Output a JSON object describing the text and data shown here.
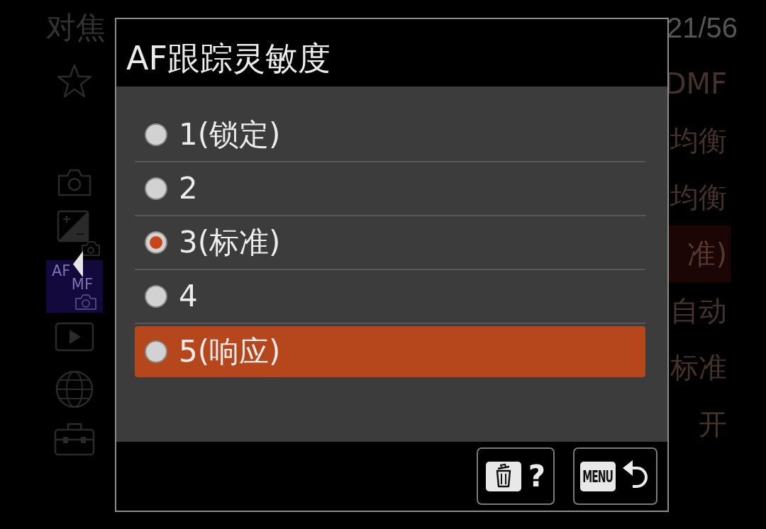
{
  "background_menu": {
    "breadcrumb": "对焦",
    "page_counter": "21/56",
    "tabs": [
      {
        "kind": "star",
        "selected": false
      },
      {
        "kind": "camera",
        "selected": false
      },
      {
        "kind": "exposure",
        "selected": false
      },
      {
        "kind": "focus",
        "labels": [
          "AF",
          "MF"
        ],
        "selected": true
      },
      {
        "kind": "play",
        "selected": false
      },
      {
        "kind": "network",
        "selected": false
      },
      {
        "kind": "toolbox",
        "selected": false
      }
    ],
    "values": [
      {
        "text": "DMF",
        "selected": false
      },
      {
        "text": "均衡",
        "selected": false
      },
      {
        "text": "均衡",
        "selected": false
      },
      {
        "text": "准)",
        "selected": true
      },
      {
        "text": "自动",
        "selected": false
      },
      {
        "text": "标准",
        "selected": false
      },
      {
        "text": "开",
        "selected": false
      }
    ]
  },
  "dialog": {
    "title": "AF跟踪灵敏度",
    "options": [
      {
        "label": "1(锁定)",
        "checked": false,
        "selected": false
      },
      {
        "label": "2",
        "checked": false,
        "selected": false
      },
      {
        "label": "3(标准)",
        "checked": true,
        "selected": false
      },
      {
        "label": "4",
        "checked": false,
        "selected": false
      },
      {
        "label": "5(响应)",
        "checked": false,
        "selected": true
      }
    ],
    "buttons": [
      {
        "kind": "help",
        "label": "?"
      },
      {
        "kind": "back",
        "key": "MENU"
      }
    ]
  }
}
